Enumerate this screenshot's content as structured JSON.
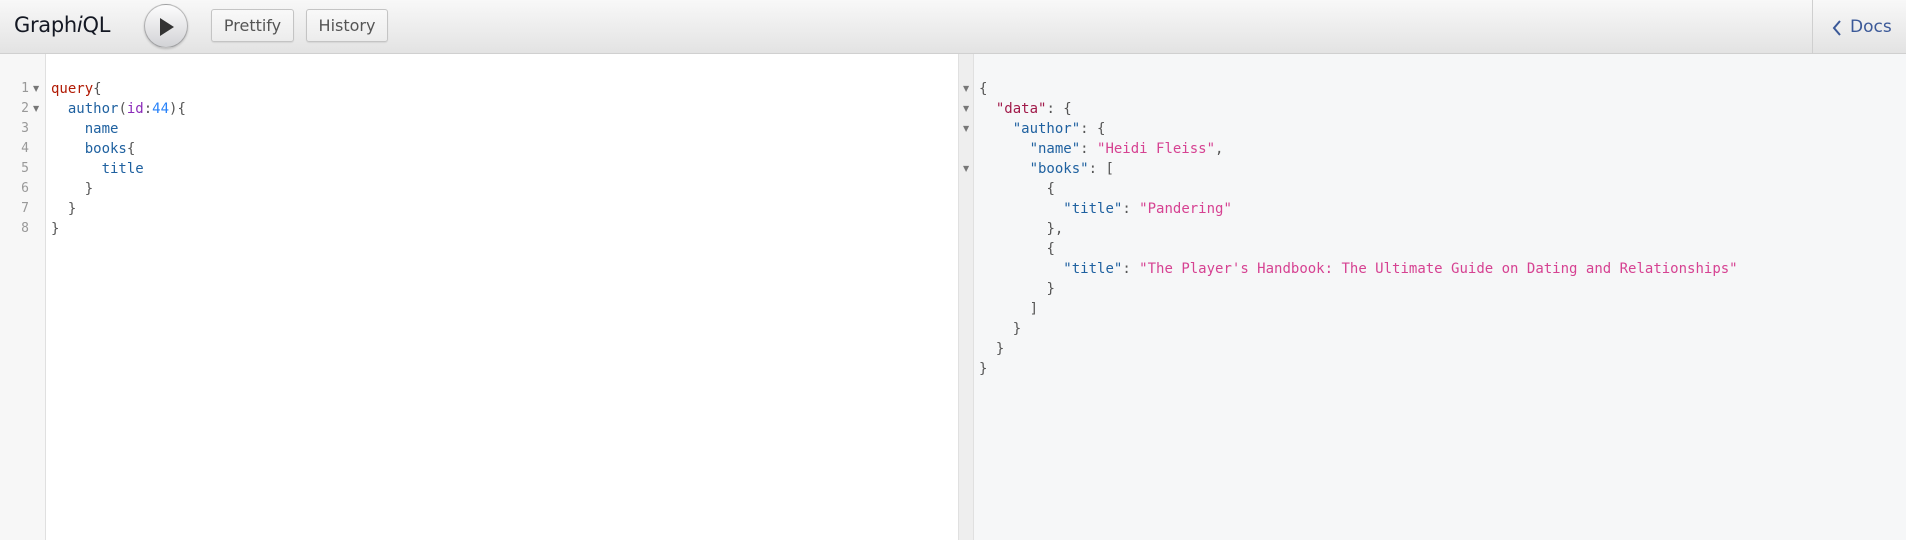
{
  "header": {
    "brand_prefix": "Graph",
    "brand_italic": "i",
    "brand_suffix": "QL",
    "prettify_label": "Prettify",
    "history_label": "History",
    "docs_label": "Docs",
    "execute_icon": "play-icon",
    "docs_icon": "chevron-left-icon"
  },
  "editor": {
    "line_numbers": [
      "1",
      "2",
      "3",
      "4",
      "5",
      "6",
      "7",
      "8"
    ],
    "lines": {
      "l1_keyword": "query",
      "l1_brace": "{",
      "l2_field": "author",
      "l2_paren_open": "(",
      "l2_arg": "id",
      "l2_colon": ":",
      "l2_value": "44",
      "l2_paren_close": "){",
      "l3_field": "name",
      "l4_field": "books",
      "l4_brace": "{",
      "l5_field": "title",
      "l6_brace": "}",
      "l7_brace": "}",
      "l8_brace": "}"
    }
  },
  "result": {
    "open_brace": "{",
    "data_key": "\"data\"",
    "author_key": "\"author\"",
    "name_key": "\"name\"",
    "name_value": "\"Heidi Fleiss\"",
    "books_key": "\"books\"",
    "title_key": "\"title\"",
    "book1_title": "\"Pandering\"",
    "book2_title": "\"The Player's Handbook: The Ultimate Guide on Dating and Relationships\"",
    "colon_brace": ": {",
    "colon_bracket": ": [",
    "colon_space": ": ",
    "comma": ",",
    "obj_open": "{",
    "obj_close_comma": "},",
    "obj_close": "}",
    "arr_close": "]"
  },
  "colors": {
    "keyword": "#b11a04",
    "field": "#1f61a0",
    "attribute": "#8b2bb9",
    "number": "#2882f9",
    "string": "#d64292",
    "docs_link": "#3b5998"
  }
}
